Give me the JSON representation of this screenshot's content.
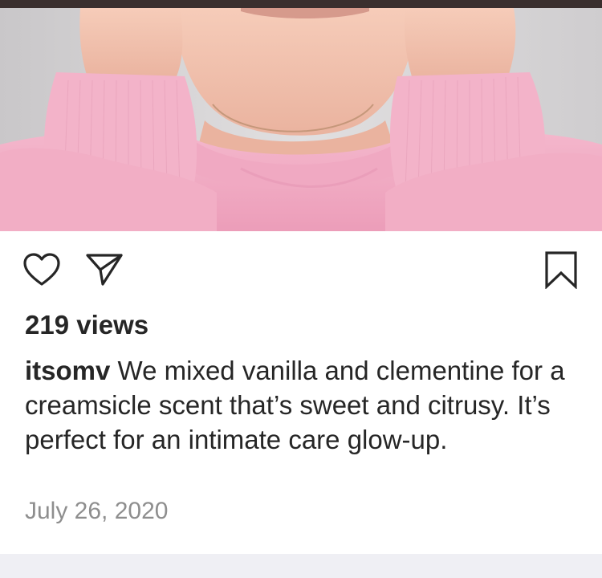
{
  "post": {
    "views_text": "219 views",
    "username": "itsomv",
    "caption": "We mixed vanilla and clementine for a creamsicle scent that’s sweet and citrusy. It’s perfect for an intimate care glow-up.",
    "date": "July 26, 2020"
  },
  "actions": {
    "like_icon": "heart-outline-icon",
    "share_icon": "paper-plane-icon",
    "save_icon": "bookmark-outline-icon"
  },
  "colors": {
    "text": "#262626",
    "muted": "#8e8e8e",
    "hoodie_pink": "#f0a9c2",
    "background": "#ffffff"
  }
}
